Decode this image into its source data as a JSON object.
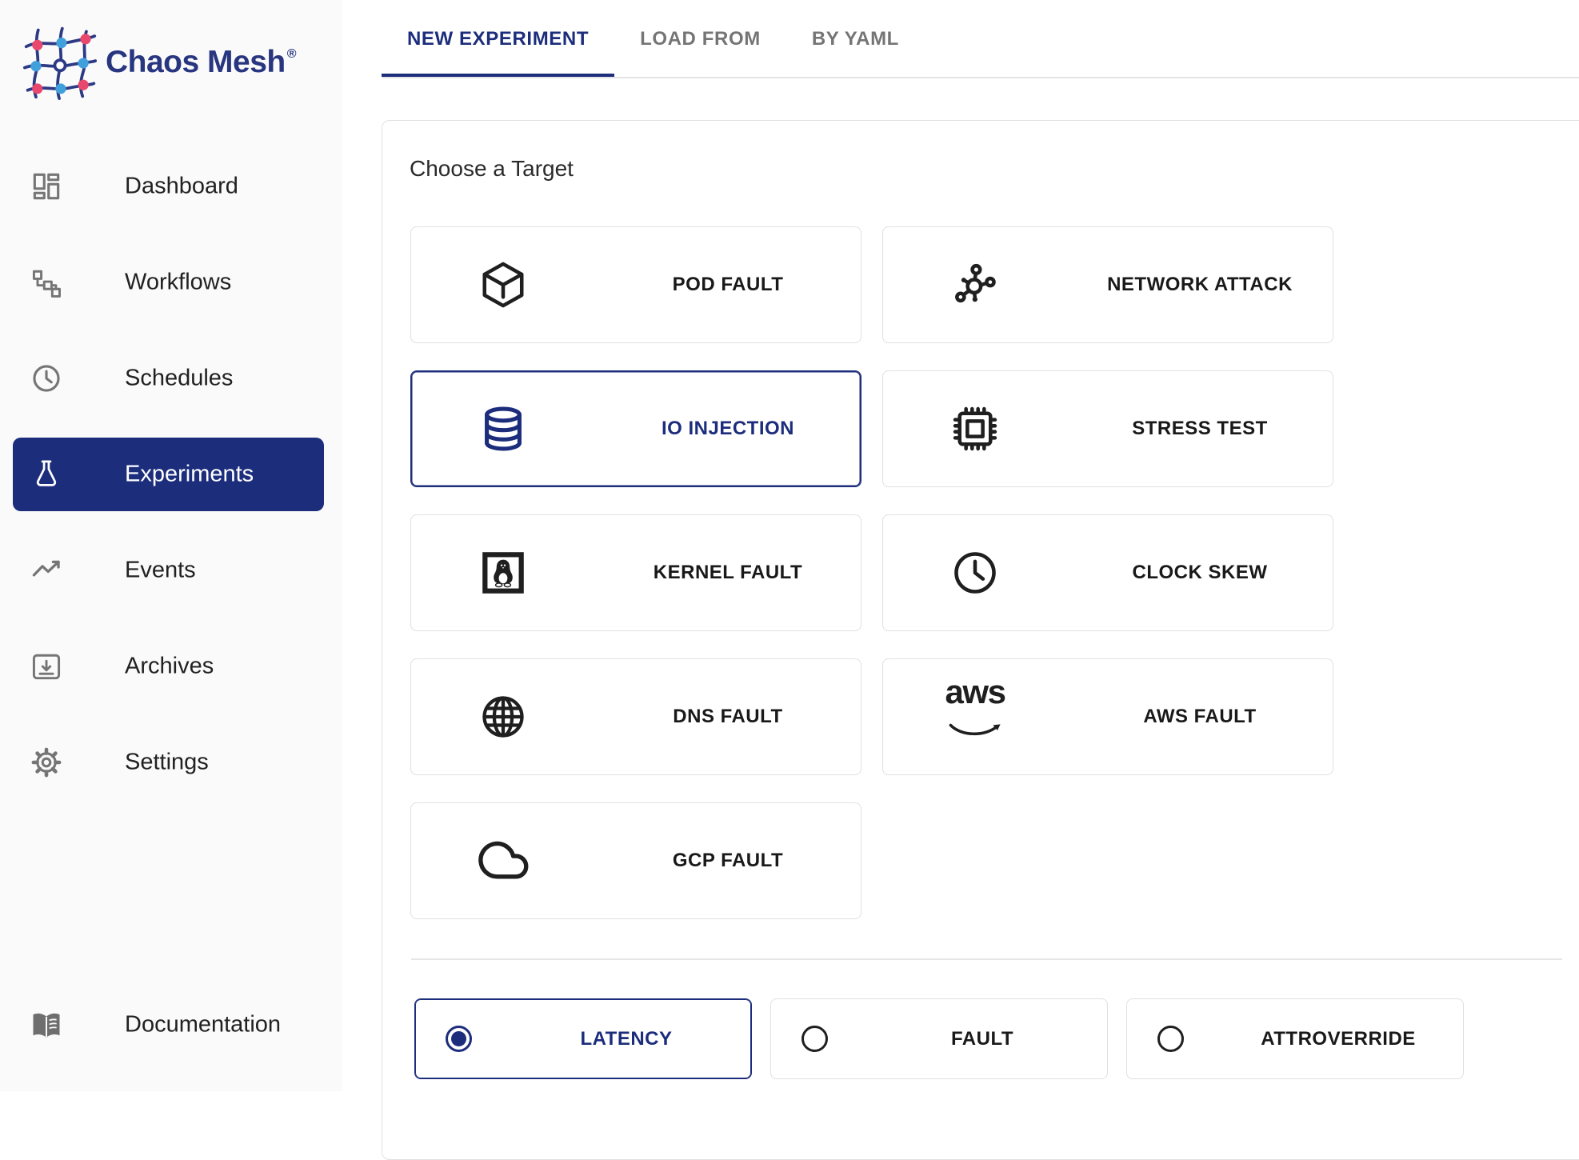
{
  "brand": {
    "name": "Chaos Mesh",
    "registered_mark": "®"
  },
  "sidebar": {
    "items": [
      {
        "label": "Dashboard",
        "icon": "dashboard-icon",
        "active": false
      },
      {
        "label": "Workflows",
        "icon": "workflows-icon",
        "active": false
      },
      {
        "label": "Schedules",
        "icon": "schedules-icon",
        "active": false
      },
      {
        "label": "Experiments",
        "icon": "experiments-flask-icon",
        "active": true
      },
      {
        "label": "Events",
        "icon": "events-chart-icon",
        "active": false
      },
      {
        "label": "Archives",
        "icon": "archives-icon",
        "active": false
      },
      {
        "label": "Settings",
        "icon": "settings-gear-icon",
        "active": false
      }
    ],
    "footer_item": {
      "label": "Documentation",
      "icon": "documentation-book-icon",
      "active": false
    }
  },
  "tabs": [
    {
      "label": "NEW EXPERIMENT",
      "active": true
    },
    {
      "label": "LOAD FROM",
      "active": false
    },
    {
      "label": "BY YAML",
      "active": false
    }
  ],
  "panel": {
    "title": "Choose a Target",
    "targets": [
      {
        "label": "POD FAULT",
        "icon": "pod-cube-icon",
        "selected": false
      },
      {
        "label": "NETWORK ATTACK",
        "icon": "network-nodes-icon",
        "selected": false
      },
      {
        "label": "IO INJECTION",
        "icon": "database-icon",
        "selected": true
      },
      {
        "label": "STRESS TEST",
        "icon": "cpu-chip-icon",
        "selected": false
      },
      {
        "label": "KERNEL FAULT",
        "icon": "linux-tux-icon",
        "selected": false
      },
      {
        "label": "CLOCK SKEW",
        "icon": "clock-icon",
        "selected": false
      },
      {
        "label": "DNS FAULT",
        "icon": "globe-icon",
        "selected": false
      },
      {
        "label": "AWS FAULT",
        "icon": "aws-logo-icon",
        "selected": false
      },
      {
        "label": "GCP FAULT",
        "icon": "cloud-icon",
        "selected": false
      }
    ],
    "actions": [
      {
        "label": "LATENCY",
        "selected": true
      },
      {
        "label": "FAULT",
        "selected": false
      },
      {
        "label": "ATTROVERRIDE",
        "selected": false
      }
    ]
  },
  "icons": {
    "aws_wordmark": "aws"
  },
  "colors": {
    "primary": "#1c2d7c",
    "logo_text": "#28357f",
    "inactive_tab": "#757575",
    "sidebar_bg": "#fafafa",
    "card_border": "#e0e0e0",
    "node_red": "#e8486d",
    "node_blue": "#41a0dc"
  }
}
